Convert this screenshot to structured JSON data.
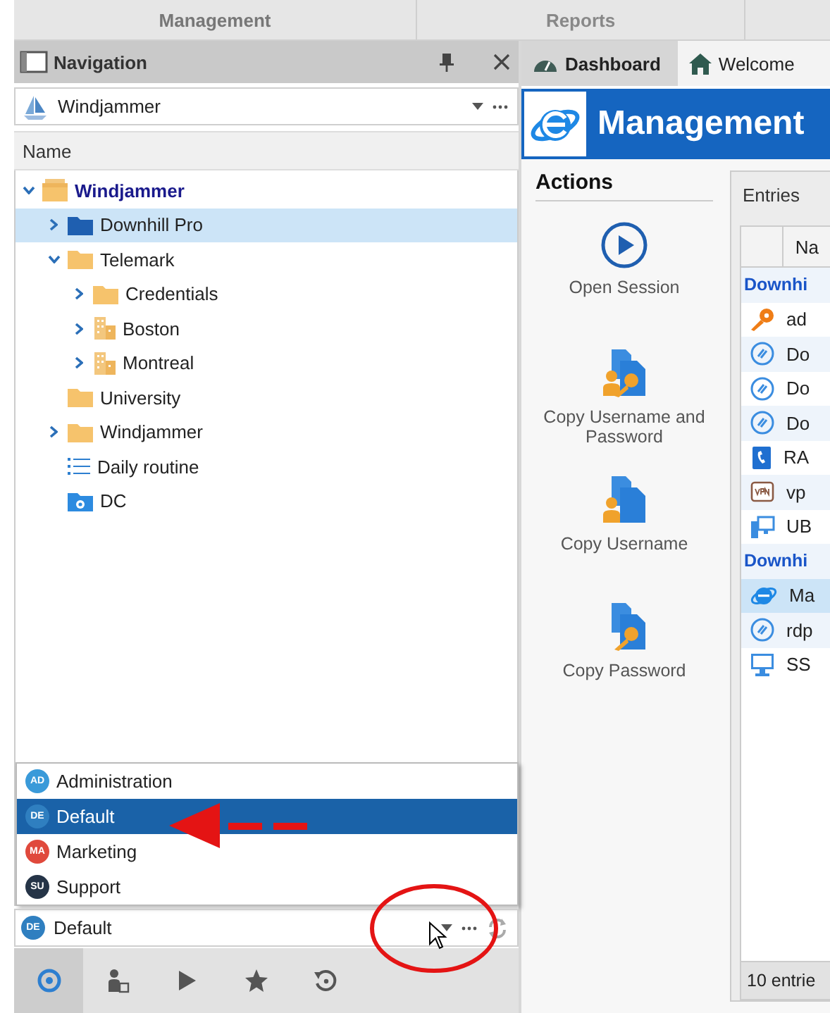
{
  "top_tabs": [
    {
      "label": "Management",
      "selected": true
    },
    {
      "label": "Reports",
      "selected": false
    }
  ],
  "navigation": {
    "title": "Navigation",
    "vault": "Windjammer",
    "column": "Name",
    "tree": [
      {
        "label": "Windjammer",
        "kind": "stack",
        "expanded": true,
        "selected": false,
        "children": [
          {
            "label": "Downhill Pro",
            "kind": "folder-dark",
            "expanded": false,
            "selected": true
          },
          {
            "label": "Telemark",
            "kind": "folder",
            "expanded": true,
            "selected": false,
            "children": [
              {
                "label": "Credentials",
                "kind": "folder",
                "expanded": false,
                "selected": false
              },
              {
                "label": "Boston",
                "kind": "building",
                "expanded": false,
                "selected": false
              },
              {
                "label": "Montreal",
                "kind": "building",
                "expanded": false,
                "selected": false
              }
            ]
          },
          {
            "label": "University",
            "kind": "folder",
            "selected": false
          },
          {
            "label": "Windjammer",
            "kind": "folder",
            "expanded": false,
            "selected": false
          },
          {
            "label": "Daily routine",
            "kind": "list",
            "selected": false
          },
          {
            "label": "DC",
            "kind": "camera",
            "selected": false
          }
        ]
      }
    ],
    "data_sources": [
      {
        "badge": "AD",
        "label": "Administration",
        "color": "#3a9ad9",
        "selected": false
      },
      {
        "badge": "DE",
        "label": "Default",
        "color": "#2f7fc0",
        "selected": true
      },
      {
        "badge": "MA",
        "label": "Marketing",
        "color": "#e0493c",
        "selected": false
      },
      {
        "badge": "SU",
        "label": "Support",
        "color": "#253447",
        "selected": false
      }
    ],
    "current_source": {
      "badge": "DE",
      "value": "Default",
      "color": "#2f7fc0"
    },
    "bottom_tools": [
      {
        "kind": "sessions",
        "selected": true
      },
      {
        "kind": "user",
        "selected": false
      },
      {
        "kind": "play",
        "selected": false
      },
      {
        "kind": "star",
        "selected": false
      },
      {
        "kind": "history",
        "selected": false
      }
    ]
  },
  "doc_tabs": [
    {
      "label": "Dashboard",
      "kind": "dashboard",
      "selected": true
    },
    {
      "label": "Welcome",
      "kind": "home",
      "selected": false
    }
  ],
  "banner": {
    "title": "Management"
  },
  "actions": {
    "title": "Actions",
    "items": [
      {
        "label": "Open Session",
        "kind": "play"
      },
      {
        "label": "Copy Username and Password",
        "kind": "user-key"
      },
      {
        "label": "Copy Username",
        "kind": "user"
      },
      {
        "label": "Copy Password",
        "kind": "key"
      }
    ]
  },
  "entries": {
    "tab": "Entries",
    "column": "Na",
    "rows": [
      {
        "kind": "group",
        "label": "Downhi"
      },
      {
        "kind": "key",
        "label": "ad",
        "selected": false
      },
      {
        "kind": "rdp",
        "label": "Do",
        "selected": false
      },
      {
        "kind": "rdp",
        "label": "Do",
        "selected": false
      },
      {
        "kind": "rdp",
        "label": "Do",
        "selected": false
      },
      {
        "kind": "phone",
        "label": "RA",
        "selected": false
      },
      {
        "kind": "vpn",
        "label": "vp",
        "selected": false
      },
      {
        "kind": "monitor",
        "label": "UB",
        "selected": false
      },
      {
        "kind": "group",
        "label": "Downhi"
      },
      {
        "kind": "ie",
        "label": "Ma",
        "selected": true
      },
      {
        "kind": "rdp",
        "label": "rdp",
        "selected": false
      },
      {
        "kind": "ssh",
        "label": "SS",
        "selected": false
      }
    ],
    "footer": "10 entrie"
  }
}
